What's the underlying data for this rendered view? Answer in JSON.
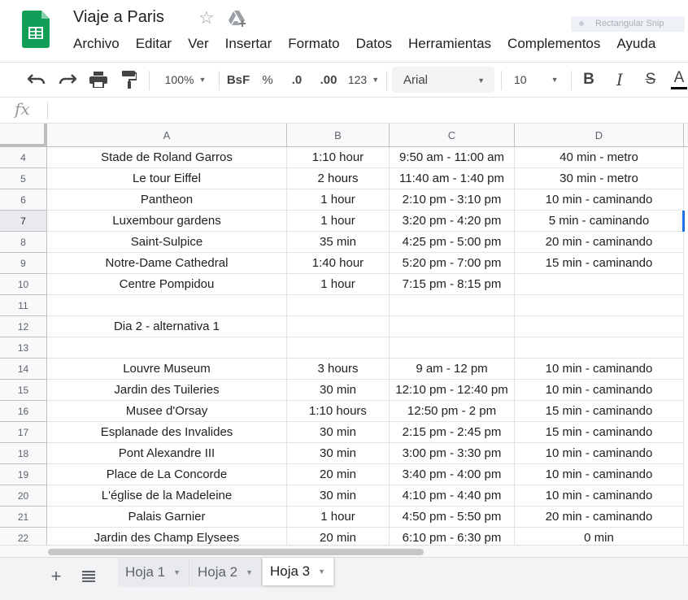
{
  "doc": {
    "title": "Viaje a Paris"
  },
  "menu": [
    "Archivo",
    "Editar",
    "Ver",
    "Insertar",
    "Formato",
    "Datos",
    "Herramientas",
    "Complementos",
    "Ayuda"
  ],
  "snip": {
    "label": "Rectangular Snip"
  },
  "toolbar": {
    "zoom": "100%",
    "currency_label": "BsF",
    "percent_label": "%",
    "dec_decrease": ".0",
    "dec_increase": ".00",
    "number_format": "123",
    "font": "Arial",
    "font_size": "10",
    "bold": "B",
    "italic": "I",
    "strike": "S",
    "text_color": "A"
  },
  "formula": {
    "fx_label": "fx",
    "value": ""
  },
  "columns": [
    "A",
    "B",
    "C",
    "D"
  ],
  "rows": [
    {
      "n": "4",
      "a": "Stade de Roland Garros",
      "b": "1:10 hour",
      "c": "9:50 am - 11:00 am",
      "d": "40 min - metro"
    },
    {
      "n": "5",
      "a": "Le tour Eiffel",
      "b": "2 hours",
      "c": "11:40 am - 1:40 pm",
      "d": "30 min - metro"
    },
    {
      "n": "6",
      "a": "Pantheon",
      "b": "1 hour",
      "c": "2:10 pm - 3:10 pm",
      "d": "10 min - caminando"
    },
    {
      "n": "7",
      "a": "Luxembour gardens",
      "b": "1 hour",
      "c": "3:20 pm - 4:20 pm",
      "d": "5 min - caminando"
    },
    {
      "n": "8",
      "a": "Saint-Sulpice",
      "b": "35 min",
      "c": "4:25 pm - 5:00 pm",
      "d": "20 min - caminando"
    },
    {
      "n": "9",
      "a": "Notre-Dame Cathedral",
      "b": "1:40 hour",
      "c": "5:20 pm - 7:00 pm",
      "d": "15 min - caminando"
    },
    {
      "n": "10",
      "a": "Centre Pompidou",
      "b": "1 hour",
      "c": "7:15 pm - 8:15 pm",
      "d": ""
    },
    {
      "n": "11",
      "a": "",
      "b": "",
      "c": "",
      "d": ""
    },
    {
      "n": "12",
      "a": "Dia 2 - alternativa 1",
      "b": "",
      "c": "",
      "d": ""
    },
    {
      "n": "13",
      "a": "",
      "b": "",
      "c": "",
      "d": ""
    },
    {
      "n": "14",
      "a": "Louvre Museum",
      "b": "3 hours",
      "c": "9 am - 12 pm",
      "d": "10 min - caminando"
    },
    {
      "n": "15",
      "a": "Jardin des Tuileries",
      "b": "30 min",
      "c": "12:10 pm - 12:40 pm",
      "d": "10 min  - caminando"
    },
    {
      "n": "16",
      "a": "Musee d'Orsay",
      "b": "1:10 hours",
      "c": "12:50 pm - 2 pm",
      "d": "15 min - caminando"
    },
    {
      "n": "17",
      "a": "Esplanade des Invalides",
      "b": "30 min",
      "c": "2:15 pm - 2:45 pm",
      "d": "15 min - caminando"
    },
    {
      "n": "18",
      "a": "Pont Alexandre III",
      "b": "30 min",
      "c": "3:00 pm - 3:30 pm",
      "d": "10 min - caminando"
    },
    {
      "n": "19",
      "a": "Place de La Concorde",
      "b": "20 min",
      "c": "3:40 pm - 4:00 pm",
      "d": "10 min - caminando"
    },
    {
      "n": "20",
      "a": "L'église de la Madeleine",
      "b": "30 min",
      "c": "4:10 pm - 4:40 pm",
      "d": "10 min - caminando"
    },
    {
      "n": "21",
      "a": "Palais Garnier",
      "b": "1 hour",
      "c": "4:50 pm - 5:50 pm",
      "d": "20 min - caminando"
    },
    {
      "n": "22",
      "a": "Jardin des Champ Elysees",
      "b": "20 min",
      "c": "6:10 pm - 6:30 pm",
      "d": "0 min"
    }
  ],
  "active_row": "7",
  "sheets": [
    {
      "label": "Hoja 1",
      "active": false
    },
    {
      "label": "Hoja 2",
      "active": false
    },
    {
      "label": "Hoja 3",
      "active": true
    }
  ],
  "colors": {
    "accent": "#1a73e8",
    "sheets_green": "#0f9d58"
  }
}
